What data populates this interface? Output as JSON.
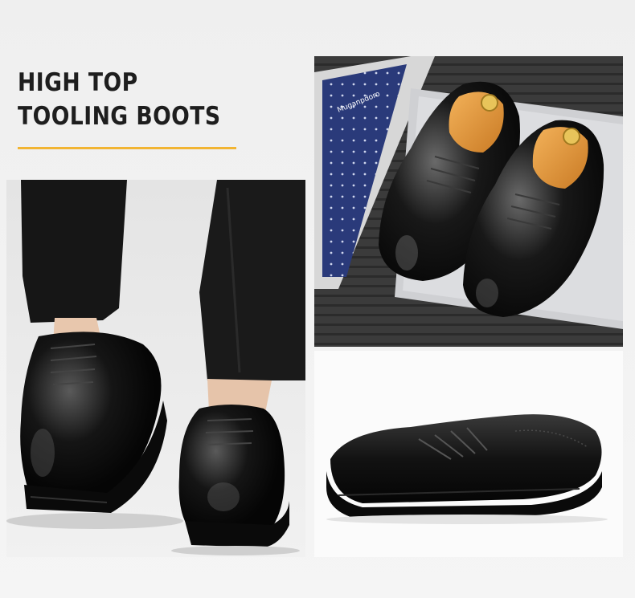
{
  "headline": {
    "line1": "HIGH TOP",
    "line2": "TOOLING BOOTS"
  },
  "colors": {
    "accent_rule": "#f2b533",
    "headline_text": "#1e1e1e",
    "background": "#f2f2f2"
  },
  "photos": {
    "legs": {
      "subject": "person in black trousers wearing black brogue shoes"
    },
    "top": {
      "subject": "pair of black brogue shoes with shoe trees on laptop, tie and box",
      "box_text": "Muganpdoro"
    },
    "side": {
      "subject": "single black brogue shoe side view"
    }
  }
}
